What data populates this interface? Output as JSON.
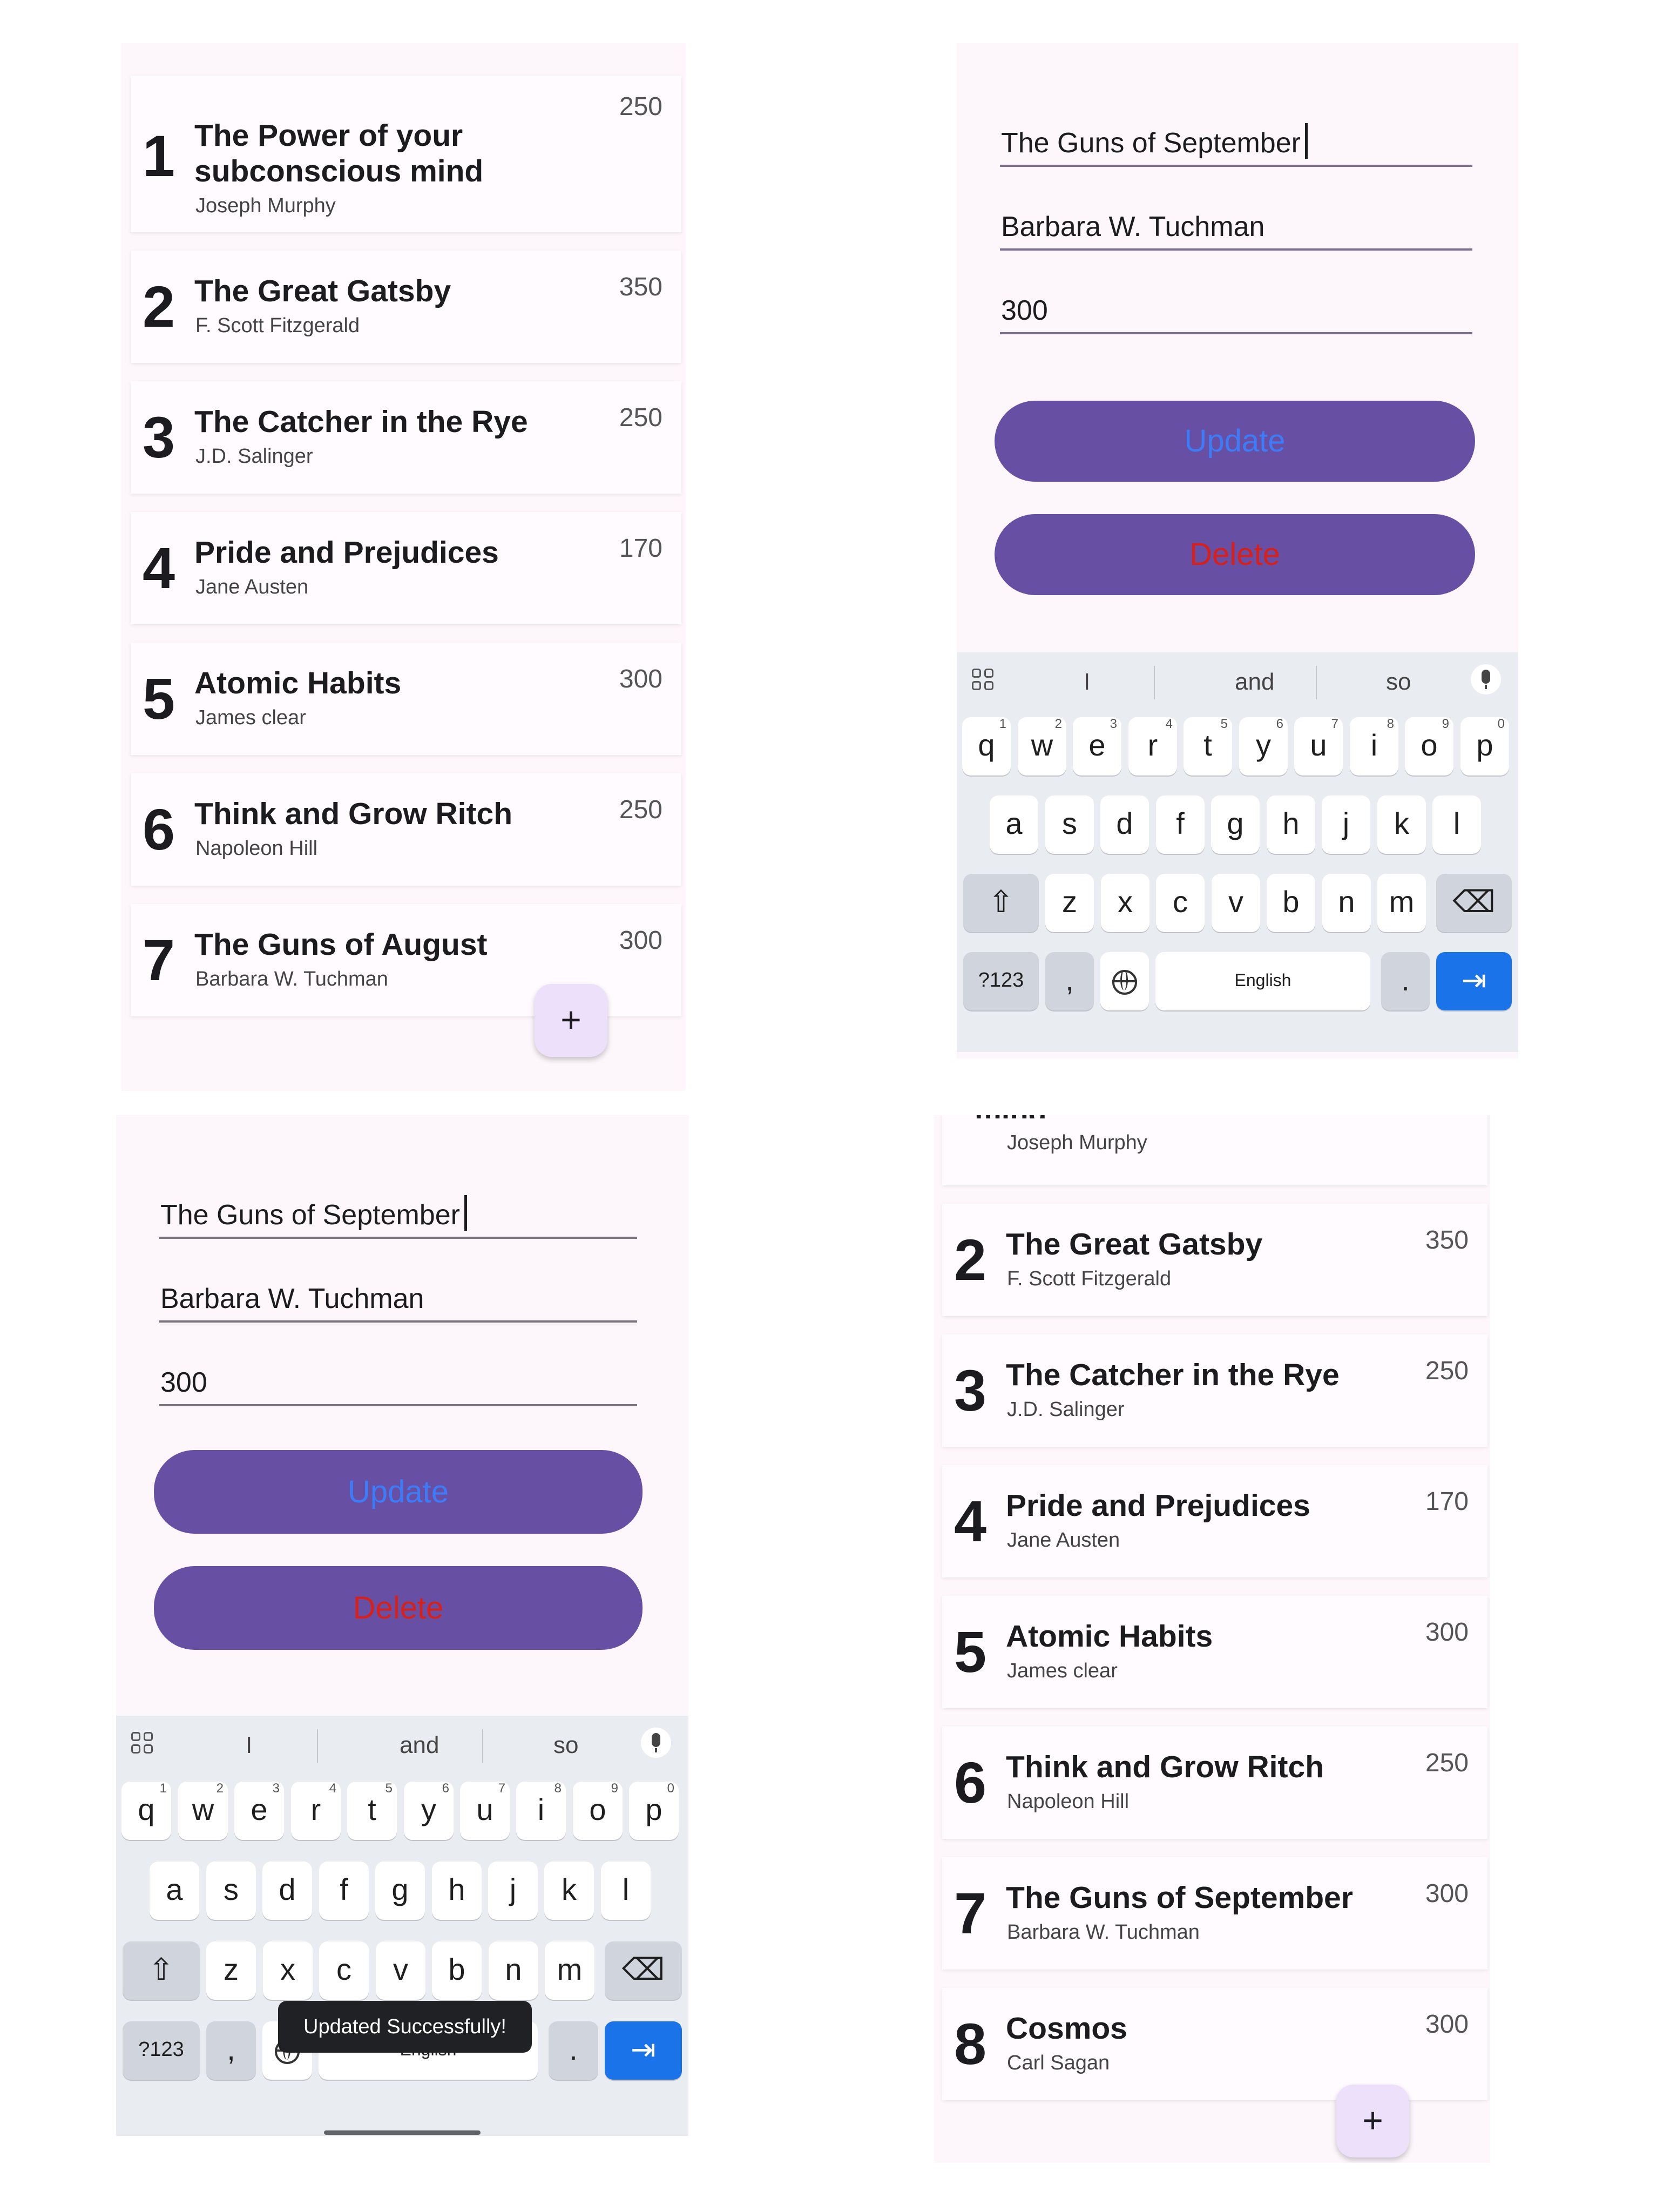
{
  "books": [
    {
      "num": "1",
      "title": "The Power of your subconscious mind",
      "author": "Joseph Murphy",
      "price": "250"
    },
    {
      "num": "2",
      "title": "The Great Gatsby",
      "author": "F. Scott Fitzgerald",
      "price": "350"
    },
    {
      "num": "3",
      "title": "The Catcher in the Rye",
      "author": "J.D. Salinger",
      "price": "250"
    },
    {
      "num": "4",
      "title": "Pride and Prejudices",
      "author": "Jane Austen",
      "price": "170"
    },
    {
      "num": "5",
      "title": "Atomic Habits",
      "author": "James clear",
      "price": "300"
    },
    {
      "num": "6",
      "title": "Think and Grow Ritch",
      "author": "Napoleon Hill",
      "price": "250"
    },
    {
      "num": "7",
      "title": "The Guns of August",
      "author": "Barbara W. Tuchman",
      "price": "300"
    }
  ],
  "books_updated": [
    {
      "num": "",
      "title": "mind",
      "author": "Joseph Murphy",
      "price": ""
    },
    {
      "num": "2",
      "title": "The Great Gatsby",
      "author": "F. Scott Fitzgerald",
      "price": "350"
    },
    {
      "num": "3",
      "title": "The Catcher in the Rye",
      "author": "J.D. Salinger",
      "price": "250"
    },
    {
      "num": "4",
      "title": "Pride and Prejudices",
      "author": "Jane Austen",
      "price": "170"
    },
    {
      "num": "5",
      "title": "Atomic Habits",
      "author": "James clear",
      "price": "300"
    },
    {
      "num": "6",
      "title": "Think and Grow Ritch",
      "author": "Napoleon Hill",
      "price": "250"
    },
    {
      "num": "7",
      "title": "The Guns of September",
      "author": "Barbara W. Tuchman",
      "price": "300"
    },
    {
      "num": "8",
      "title": "Cosmos",
      "author": "Carl Sagan",
      "price": "300"
    }
  ],
  "fab": {
    "label": "+"
  },
  "edit_form": {
    "title_value": "The Guns of September",
    "author_value": "Barbara W. Tuchman",
    "price_value": "300",
    "update_label": "Update",
    "delete_label": "Delete"
  },
  "keyboard": {
    "suggestions": [
      "I",
      "and",
      "so"
    ],
    "rows": [
      [
        {
          "k": "q",
          "h": "1"
        },
        {
          "k": "w",
          "h": "2"
        },
        {
          "k": "e",
          "h": "3"
        },
        {
          "k": "r",
          "h": "4"
        },
        {
          "k": "t",
          "h": "5"
        },
        {
          "k": "y",
          "h": "6"
        },
        {
          "k": "u",
          "h": "7"
        },
        {
          "k": "i",
          "h": "8"
        },
        {
          "k": "o",
          "h": "9"
        },
        {
          "k": "p",
          "h": "0"
        }
      ],
      [
        {
          "k": "a"
        },
        {
          "k": "s"
        },
        {
          "k": "d"
        },
        {
          "k": "f"
        },
        {
          "k": "g"
        },
        {
          "k": "h"
        },
        {
          "k": "j"
        },
        {
          "k": "k"
        },
        {
          "k": "l"
        }
      ],
      [
        {
          "k": "z"
        },
        {
          "k": "x"
        },
        {
          "k": "c"
        },
        {
          "k": "v"
        },
        {
          "k": "b"
        },
        {
          "k": "n"
        },
        {
          "k": "m"
        }
      ]
    ],
    "symbols_label": "?123",
    "comma_label": ",",
    "space_label": "English",
    "period_label": ".",
    "shift_icon": "shift-icon",
    "backspace_icon": "backspace-icon",
    "enter_icon": "tab-next-icon"
  },
  "toast": {
    "message": "Updated Successfully!"
  }
}
